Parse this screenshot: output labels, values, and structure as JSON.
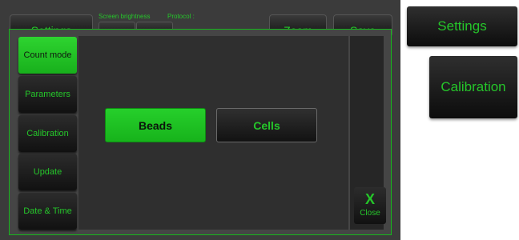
{
  "background": {
    "settings_label": "Settings",
    "screen_brightness_label": "Screen brightness",
    "protocol_label": "Protocol :",
    "zoom_label": "Zoom",
    "save_label": "Save"
  },
  "sidebar": {
    "items": [
      {
        "label": "Count mode",
        "active": true
      },
      {
        "label": "Parameters",
        "active": false
      },
      {
        "label": "Calibration",
        "active": false
      },
      {
        "label": "Update",
        "active": false
      },
      {
        "label": "Date & Time",
        "active": false
      }
    ]
  },
  "panel": {
    "beads_label": "Beads",
    "cells_label": "Cells"
  },
  "close": {
    "icon": "X",
    "label": "Close"
  },
  "crops": {
    "settings_label": "Settings",
    "calibration_label": "Calibration"
  },
  "colors": {
    "accent": "#25c62a",
    "active_fill": "#1fc424",
    "screen_bg": "#3b3b3b"
  }
}
